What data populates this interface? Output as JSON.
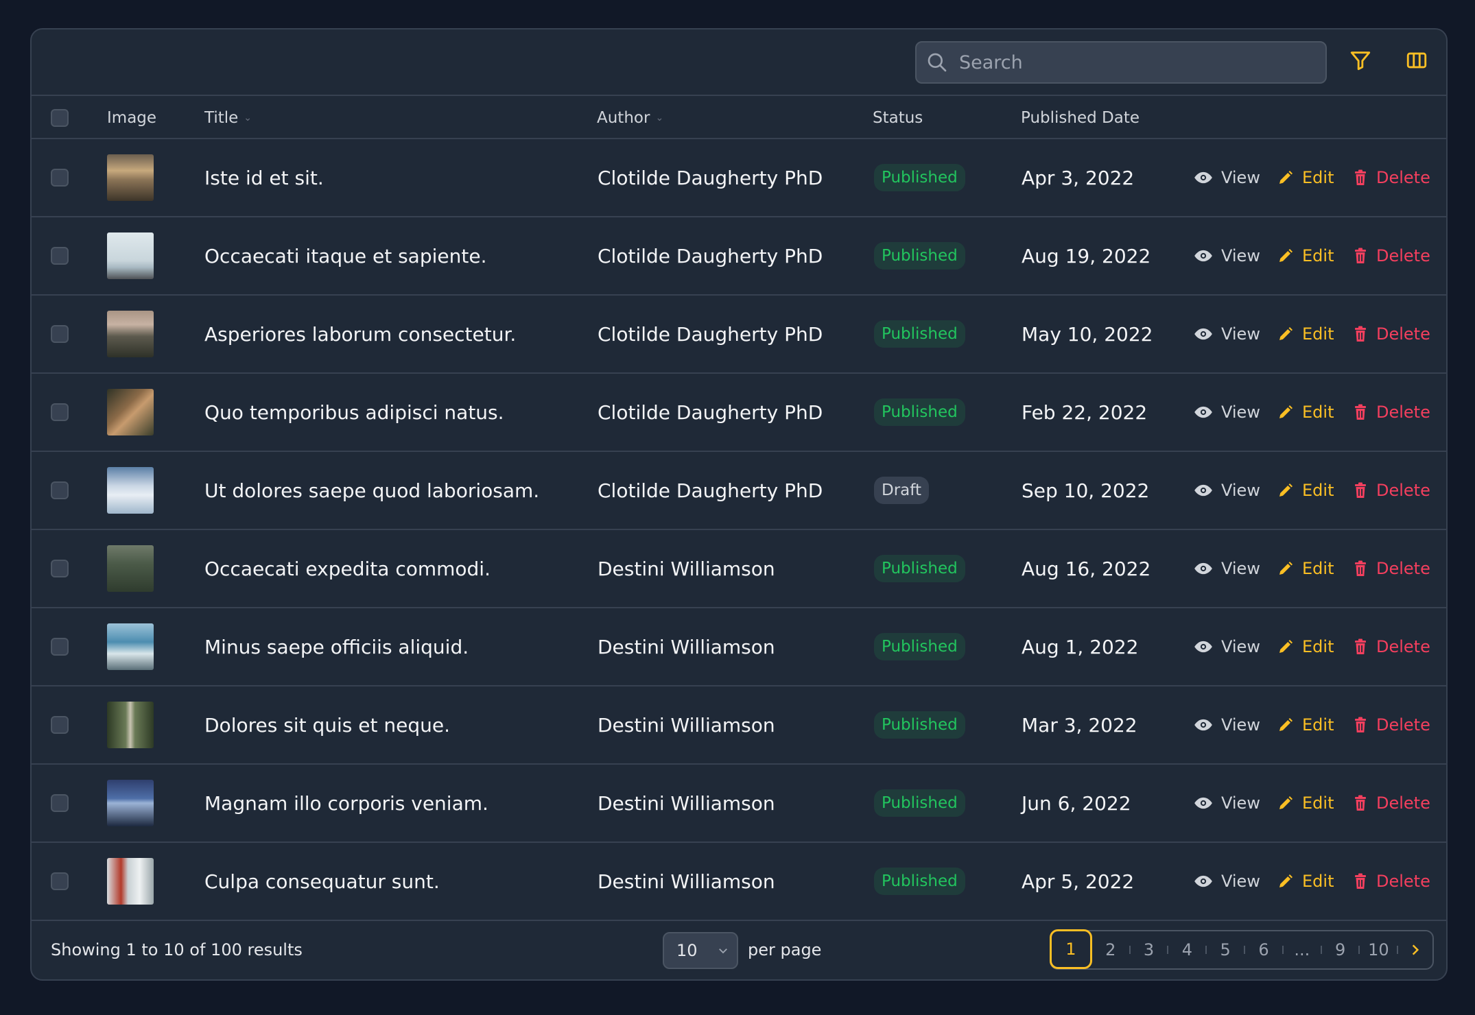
{
  "search": {
    "placeholder": "Search"
  },
  "toolbar": {
    "filter_icon": "filter-icon",
    "columns_icon": "columns-icon"
  },
  "colors": {
    "accent": "#fbbf24",
    "published": "#22c55e",
    "delete": "#f43f5e",
    "background": "#111827",
    "panel": "#1f2937"
  },
  "table": {
    "headers": {
      "image": "Image",
      "title": "Title",
      "author": "Author",
      "status": "Status",
      "published_date": "Published Date"
    },
    "actions": {
      "view": "View",
      "edit": "Edit",
      "delete": "Delete"
    },
    "rows": [
      {
        "title": "Iste id et sit.",
        "author": "Clotilde Daugherty PhD",
        "status": "Published",
        "date": "Apr 3, 2022",
        "thumb": "sunset-landscape"
      },
      {
        "title": "Occaecati itaque et sapiente.",
        "author": "Clotilde Daugherty PhD",
        "status": "Published",
        "date": "Aug 19, 2022",
        "thumb": "pier-sea"
      },
      {
        "title": "Asperiores laborum consectetur.",
        "author": "Clotilde Daugherty PhD",
        "status": "Published",
        "date": "May 10, 2022",
        "thumb": "foggy-forest"
      },
      {
        "title": "Quo temporibus adipisci natus.",
        "author": "Clotilde Daugherty PhD",
        "status": "Published",
        "date": "Feb 22, 2022",
        "thumb": "rock-cliff"
      },
      {
        "title": "Ut dolores saepe quod laboriosam.",
        "author": "Clotilde Daugherty PhD",
        "status": "Draft",
        "date": "Sep 10, 2022",
        "thumb": "cloudy-sky"
      },
      {
        "title": "Occaecati expedita commodi.",
        "author": "Destini Williamson",
        "status": "Published",
        "date": "Aug 16, 2022",
        "thumb": "misty-forest"
      },
      {
        "title": "Minus saepe officiis aliquid.",
        "author": "Destini Williamson",
        "status": "Published",
        "date": "Aug 1, 2022",
        "thumb": "ocean-wave"
      },
      {
        "title": "Dolores sit quis et neque.",
        "author": "Destini Williamson",
        "status": "Published",
        "date": "Mar 3, 2022",
        "thumb": "forest-road"
      },
      {
        "title": "Magnam illo corporis veniam.",
        "author": "Destini Williamson",
        "status": "Published",
        "date": "Jun 6, 2022",
        "thumb": "blue-horizon"
      },
      {
        "title": "Culpa consequatur sunt.",
        "author": "Destini Williamson",
        "status": "Published",
        "date": "Apr 5, 2022",
        "thumb": "golden-gate-bridge"
      }
    ]
  },
  "footer": {
    "summary": "Showing 1 to 10 of 100 results",
    "per_page_value": "10",
    "per_page_label": "per page",
    "pages": [
      "1",
      "2",
      "3",
      "4",
      "5",
      "6",
      "...",
      "9",
      "10"
    ],
    "active_page": "1"
  }
}
